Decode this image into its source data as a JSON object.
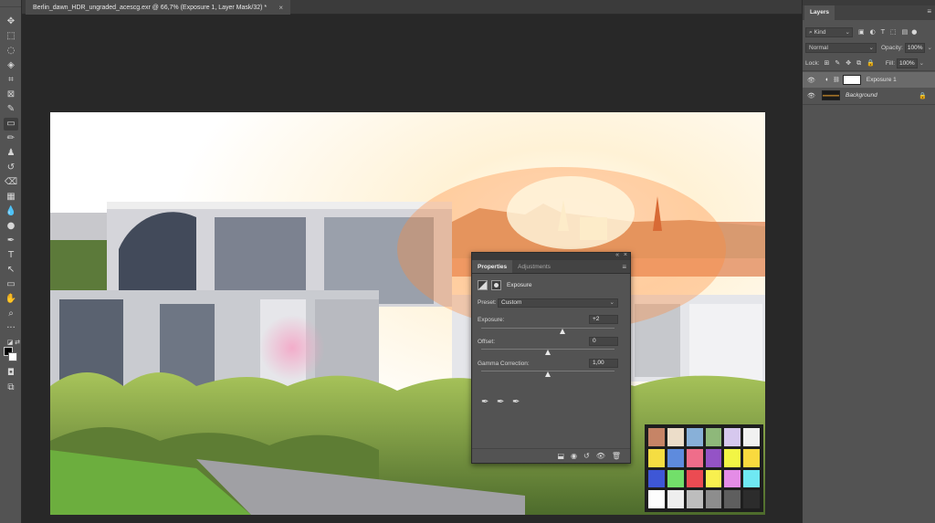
{
  "document": {
    "tab_title": "Berlin_dawn_HDR_ungraded_acescg.exr @ 66,7% (Exposure 1, Layer Mask/32) *",
    "close_glyph": "×"
  },
  "toolbar": {
    "tools": [
      {
        "name": "move-tool-icon",
        "glyph": "✥"
      },
      {
        "name": "marquee-tool-icon",
        "glyph": "⬚"
      },
      {
        "name": "lasso-tool-icon",
        "glyph": "◌"
      },
      {
        "name": "quick-select-tool-icon",
        "glyph": "◈"
      },
      {
        "name": "crop-tool-icon",
        "glyph": "⌗"
      },
      {
        "name": "frame-tool-icon",
        "glyph": "⊠"
      },
      {
        "name": "eyedropper-tool-icon",
        "glyph": "✎"
      },
      {
        "name": "healing-brush-tool-icon",
        "glyph": "▭"
      },
      {
        "name": "brush-tool-icon",
        "glyph": "✏"
      },
      {
        "name": "clone-stamp-tool-icon",
        "glyph": "♟"
      },
      {
        "name": "history-brush-tool-icon",
        "glyph": "↺"
      },
      {
        "name": "eraser-tool-icon",
        "glyph": "⌫"
      },
      {
        "name": "gradient-tool-icon",
        "glyph": "▦"
      },
      {
        "name": "blur-tool-icon",
        "glyph": "💧"
      },
      {
        "name": "dodge-tool-icon",
        "glyph": "●"
      },
      {
        "name": "pen-tool-icon",
        "glyph": "✒"
      },
      {
        "name": "type-tool-icon",
        "glyph": "T"
      },
      {
        "name": "path-select-tool-icon",
        "glyph": "↖"
      },
      {
        "name": "rectangle-tool-icon",
        "glyph": "▭"
      },
      {
        "name": "hand-tool-icon",
        "glyph": "✋"
      },
      {
        "name": "zoom-tool-icon",
        "glyph": "⌕"
      },
      {
        "name": "more-tools-icon",
        "glyph": "···"
      }
    ],
    "extra": [
      {
        "name": "quick-mask-icon",
        "glyph": "◘"
      },
      {
        "name": "screen-mode-icon",
        "glyph": "⧉"
      }
    ]
  },
  "properties": {
    "tabs": [
      "Properties",
      "Adjustments"
    ],
    "collapse_glyph": "«",
    "close_glyph": "×",
    "menu_glyph": "≡",
    "adjustment_name": "Exposure",
    "preset_label": "Preset:",
    "preset_value": "Custom",
    "exposure_label": "Exposure:",
    "exposure_value": "+2",
    "exposure_level": 0.61,
    "offset_label": "Offset:",
    "offset_value": "0",
    "offset_level": 0.5,
    "gamma_label": "Gamma Correction:",
    "gamma_value": "1,00",
    "gamma_level": 0.5,
    "footer_icons": [
      "clip-to-layer-icon",
      "view-previous-icon",
      "reset-icon",
      "visibility-icon",
      "delete-icon"
    ]
  },
  "layers": {
    "tab": "Layers",
    "menu_glyph": "≡",
    "filter_kind": "Kind",
    "blend_mode": "Normal",
    "opacity_label": "Opacity:",
    "opacity_value": "100%",
    "lock_label": "Lock:",
    "fill_label": "Fill:",
    "fill_value": "100%",
    "items": [
      {
        "name": "Exposure 1",
        "selected": true
      },
      {
        "name": "Background",
        "selected": false
      }
    ]
  },
  "colors": {
    "accent_fg": "#000000",
    "accent_bg": "#ffffff",
    "panel": "#535353",
    "checker": [
      "#c68466",
      "#ecddc9",
      "#88b0d8",
      "#8eb87a",
      "#d6c8ee",
      "#f1f1f1",
      "#f5dd42",
      "#5e8bdd",
      "#ef6d8a",
      "#9453c6",
      "#f2f545",
      "#f9d93e",
      "#3e57d6",
      "#72df6a",
      "#eb4b52",
      "#f8f04f",
      "#e48ce6",
      "#6fe8f3",
      "#fdfdfd",
      "#eeeeee",
      "#bdbdbd",
      "#8d8d8d",
      "#5e5e5e",
      "#2c2c2c"
    ]
  }
}
